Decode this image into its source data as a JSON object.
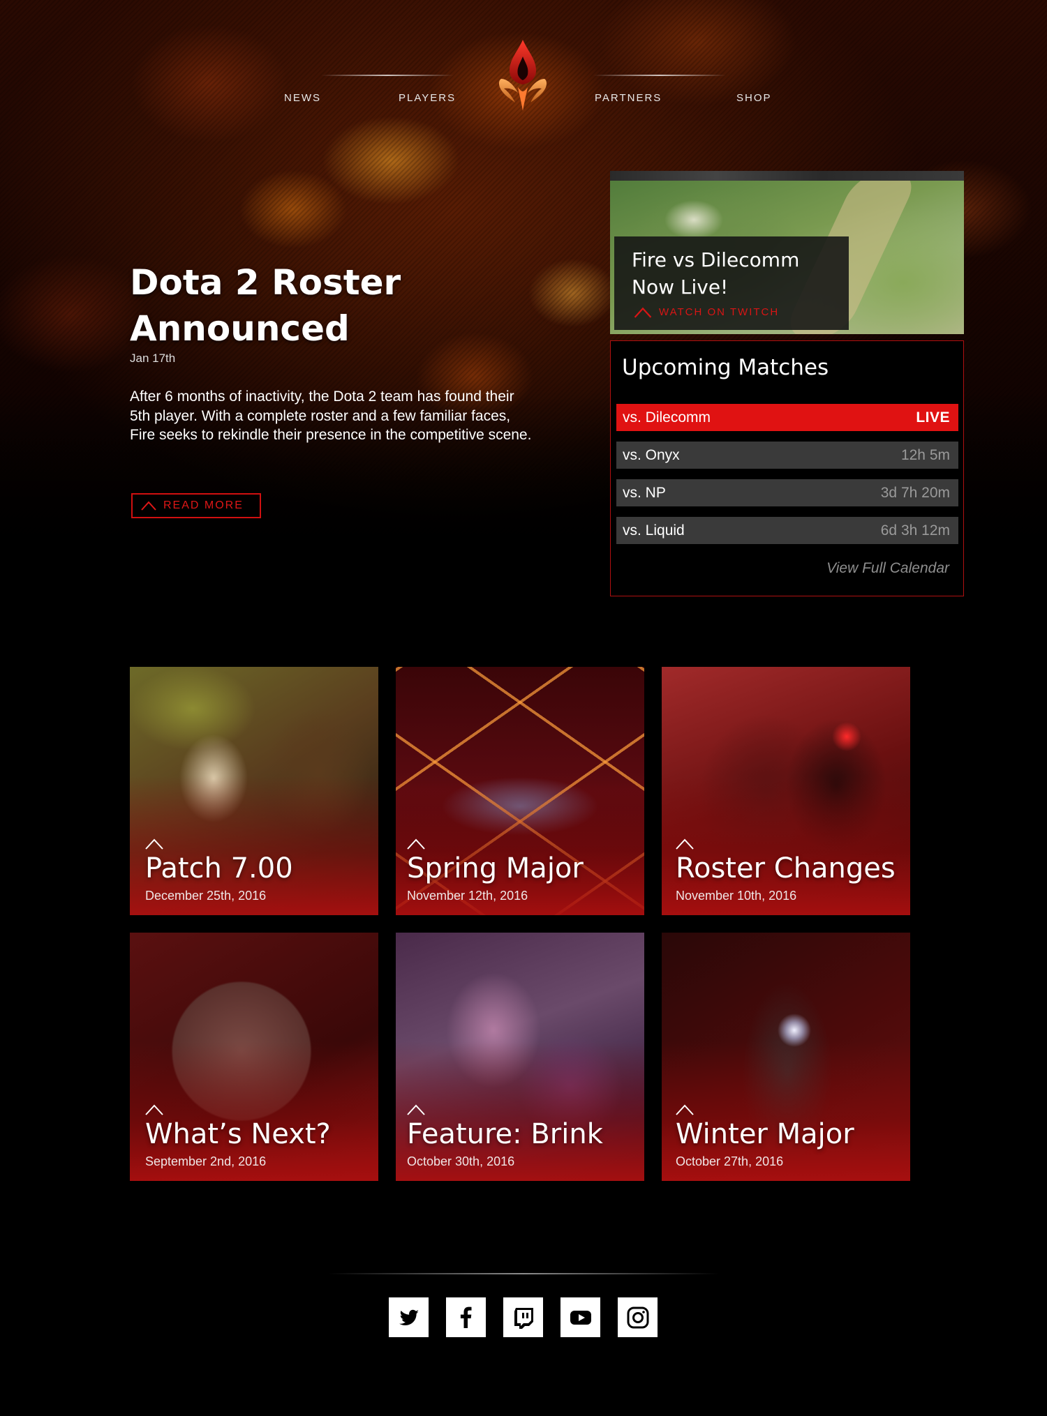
{
  "nav": {
    "items": [
      {
        "label": "NEWS"
      },
      {
        "label": "PLAYERS"
      },
      {
        "label": "PARTNERS"
      },
      {
        "label": "SHOP"
      }
    ],
    "logo_icon": "flame-logo-icon"
  },
  "hero": {
    "title": "Dota 2 Roster Announced",
    "date": "Jan 17th",
    "body": "After 6 months of inactivity, the Dota 2 team has found their 5th player. With a complete roster and a few familiar faces, Fire seeks to rekindle their presence in the competitive scene.",
    "read_more_label": "READ MORE"
  },
  "stream": {
    "title": "Fire vs Dilecomm Now Live!",
    "link_label": "WATCH ON TWITCH"
  },
  "matches": {
    "title": "Upcoming Matches",
    "rows": [
      {
        "opponent": "vs. Dilecomm",
        "time": "LIVE",
        "live": true
      },
      {
        "opponent": "vs. Onyx",
        "time": "12h 5m",
        "live": false
      },
      {
        "opponent": "vs. NP",
        "time": "3d 7h 20m",
        "live": false
      },
      {
        "opponent": "vs. Liquid",
        "time": "6d 3h 12m",
        "live": false
      }
    ],
    "calendar_link": "View Full Calendar"
  },
  "cards": [
    {
      "title": "Patch 7.00",
      "date": "December 25th, 2016"
    },
    {
      "title": "Spring Major",
      "date": "November 12th, 2016"
    },
    {
      "title": "Roster Changes",
      "date": "November 10th, 2016"
    },
    {
      "title": "What’s Next?",
      "date": "September 2nd, 2016"
    },
    {
      "title": "Feature: Brink",
      "date": "October 30th, 2016"
    },
    {
      "title": "Winter Major",
      "date": "October 27th, 2016"
    }
  ],
  "social": [
    {
      "icon": "twitter-icon"
    },
    {
      "icon": "facebook-icon"
    },
    {
      "icon": "twitch-icon"
    },
    {
      "icon": "youtube-icon"
    },
    {
      "icon": "instagram-icon"
    }
  ],
  "colors": {
    "accent": "#e01212",
    "row_bg": "#3a3a3a",
    "muted_text": "#9a9a9a"
  }
}
